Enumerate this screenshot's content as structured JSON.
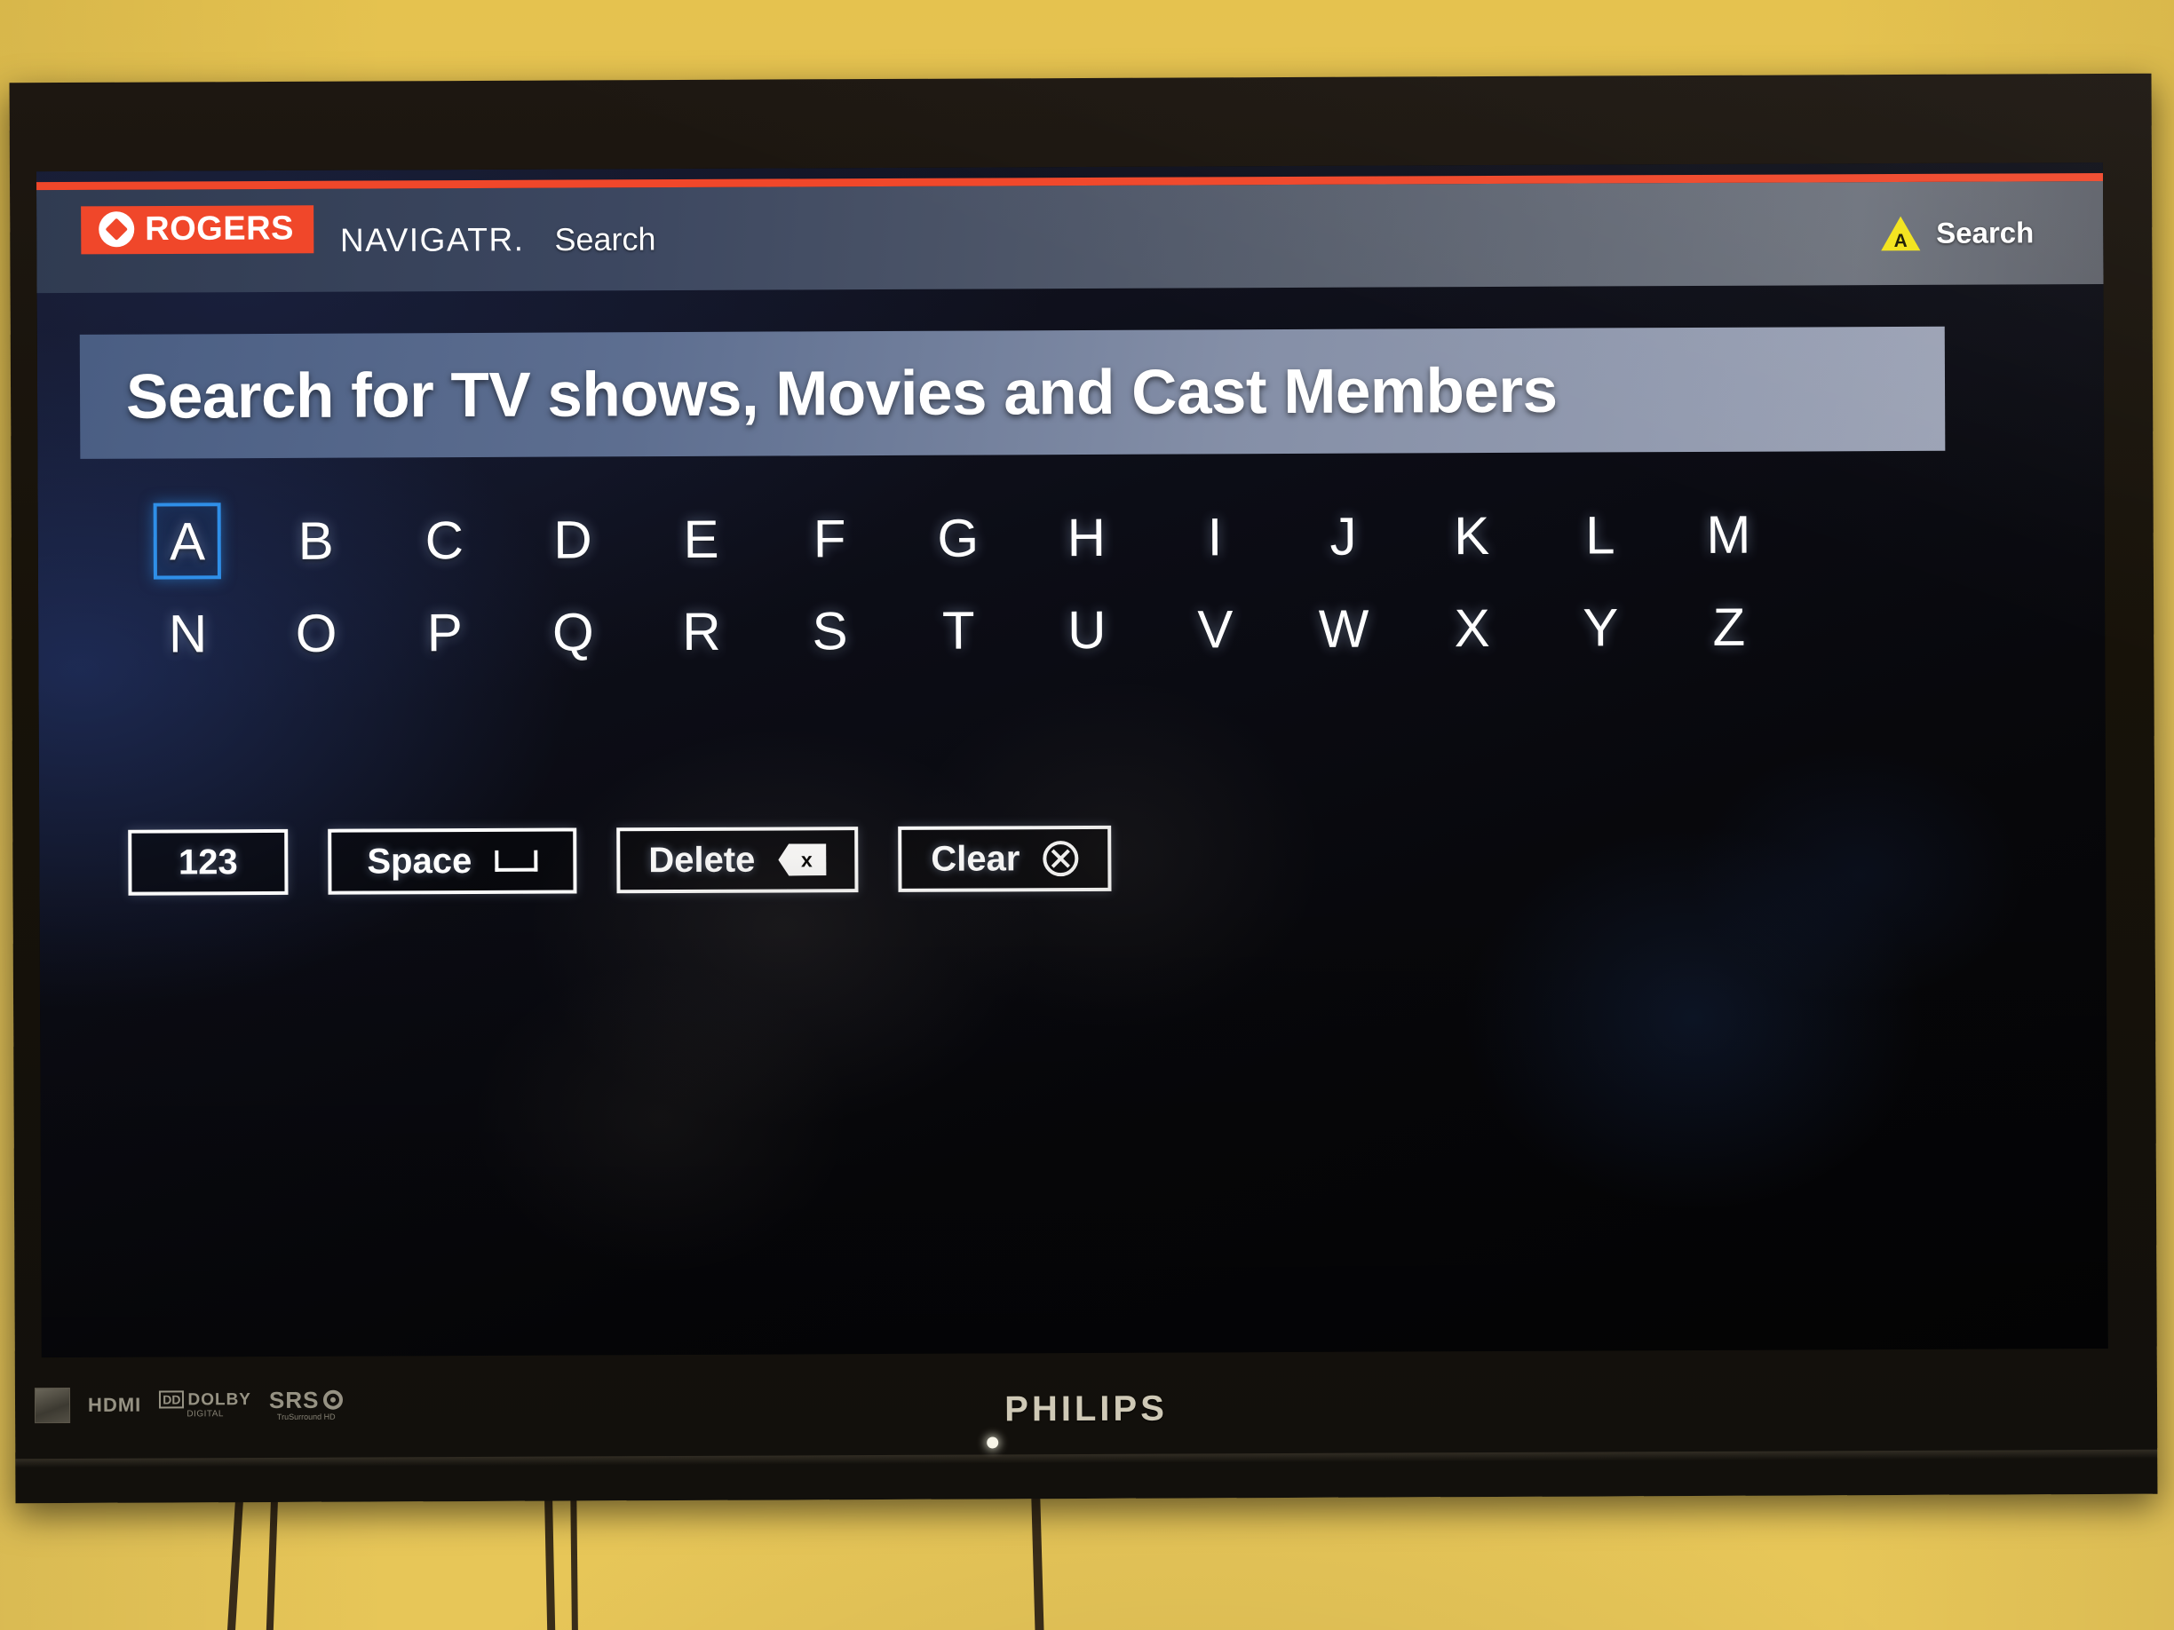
{
  "wall": {
    "color": "#e8c55c"
  },
  "tv": {
    "brand": "PHILIPS",
    "badges": [
      {
        "name": "picture-quality-badge",
        "text": ""
      },
      {
        "name": "hdmi-badge",
        "text": "HDMI"
      },
      {
        "name": "dolby-digital-badge",
        "mark": "DD",
        "text": "DOLBY",
        "sub": "DIGITAL"
      },
      {
        "name": "srs-badge",
        "text": "SRS",
        "sub": "TruSurround HD"
      }
    ]
  },
  "header": {
    "brand": "ROGERS",
    "brand_mark": "®",
    "product": "NAVIGATR.",
    "section": "Search",
    "hint": {
      "glyph": "A",
      "label": "Search"
    },
    "accent_color": "#f0472a",
    "hint_color": "#f3e419"
  },
  "banner": {
    "title": "Search for TV shows, Movies and Cast Members"
  },
  "keyboard": {
    "selected": "A",
    "selection_color": "#2f8fe8",
    "row1": [
      "A",
      "B",
      "C",
      "D",
      "E",
      "F",
      "G",
      "H",
      "I",
      "J",
      "K",
      "L",
      "M"
    ],
    "row2": [
      "N",
      "O",
      "P",
      "Q",
      "R",
      "S",
      "T",
      "U",
      "V",
      "W",
      "X",
      "Y",
      "Z"
    ]
  },
  "actions": [
    {
      "id": "numbers",
      "label": "123",
      "icon": "none"
    },
    {
      "id": "space",
      "label": "Space",
      "icon": "space-bar-icon"
    },
    {
      "id": "delete",
      "label": "Delete",
      "icon": "backspace-icon",
      "icon_glyph": "x"
    },
    {
      "id": "clear",
      "label": "Clear",
      "icon": "circle-x-icon"
    }
  ]
}
